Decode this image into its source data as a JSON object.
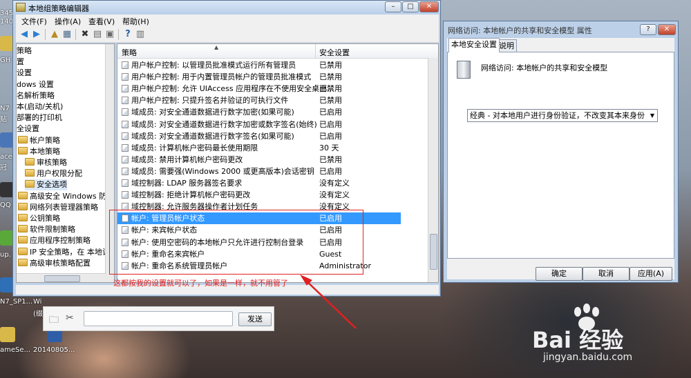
{
  "desktop": {
    "labels": [
      "345",
      "140",
      "GH",
      "N7",
      "贴",
      "ace",
      "冠",
      "QQ",
      "up.",
      "N7_SP1...",
      "Wi",
      "(缀",
      "ameSe...",
      "20140805..."
    ],
    "watermark": "Bai 经验",
    "watermark_url": "jingyan.baidu.com"
  },
  "gpedit": {
    "title": "本地组策略编辑器",
    "menu": [
      "文件(F)",
      "操作(A)",
      "查看(V)",
      "帮助(H)"
    ],
    "tree": [
      {
        "label": "策略",
        "indent": 0
      },
      {
        "label": "置",
        "indent": 0
      },
      {
        "label": "设置",
        "indent": 0
      },
      {
        "label": "dows 设置",
        "indent": 0
      },
      {
        "label": "名解析策略",
        "indent": 0
      },
      {
        "label": "本(启动/关机)",
        "indent": 0
      },
      {
        "label": "部署的打印机",
        "indent": 0
      },
      {
        "label": "全设置",
        "indent": 0
      },
      {
        "label": "帐户策略",
        "indent": 1
      },
      {
        "label": "本地策略",
        "indent": 1
      },
      {
        "label": "审核策略",
        "indent": 2
      },
      {
        "label": "用户权限分配",
        "indent": 2
      },
      {
        "label": "安全选项",
        "indent": 2
      },
      {
        "label": "高级安全 Windows 防火",
        "indent": 1
      },
      {
        "label": "网络列表管理器策略",
        "indent": 1
      },
      {
        "label": "公钥策略",
        "indent": 1
      },
      {
        "label": "软件限制策略",
        "indent": 1
      },
      {
        "label": "应用程序控制策略",
        "indent": 1
      },
      {
        "label": "IP 安全策略，在 本地计",
        "indent": 1
      },
      {
        "label": "高级审核策略配置",
        "indent": 1
      }
    ],
    "columns": {
      "policy": "策略",
      "setting": "安全设置"
    },
    "rows": [
      {
        "policy": "用户帐户控制: 以管理员批准模式运行所有管理员",
        "setting": "已禁用"
      },
      {
        "policy": "用户帐户控制: 用于内置管理员帐户的管理员批准模式",
        "setting": "已禁用"
      },
      {
        "policy": "用户帐户控制: 允许 UIAccess 应用程序在不使用安全桌面...",
        "setting": "已禁用"
      },
      {
        "policy": "用户帐户控制: 只提升签名并验证的可执行文件",
        "setting": "已禁用"
      },
      {
        "policy": "域成员: 对安全通道数据进行数字加密(如果可能)",
        "setting": "已启用"
      },
      {
        "policy": "域成员: 对安全通道数据进行数字加密或数字签名(始终)",
        "setting": "已启用"
      },
      {
        "policy": "域成员: 对安全通道数据进行数字签名(如果可能)",
        "setting": "已启用"
      },
      {
        "policy": "域成员: 计算机帐户密码最长使用期限",
        "setting": "30 天"
      },
      {
        "policy": "域成员: 禁用计算机帐户密码更改",
        "setting": "已禁用"
      },
      {
        "policy": "域成员: 需要强(Windows 2000 或更高版本)会话密钥",
        "setting": "已启用"
      },
      {
        "policy": "域控制器: LDAP 服务器签名要求",
        "setting": "没有定义"
      },
      {
        "policy": "域控制器: 拒绝计算机帐户密码更改",
        "setting": "没有定义"
      },
      {
        "policy": "域控制器: 允许服务器操作者计划任务",
        "setting": "没有定义"
      },
      {
        "policy": "帐户: 管理员帐户状态",
        "setting": "已启用"
      },
      {
        "policy": "帐户: 来宾帐户状态",
        "setting": "已启用"
      },
      {
        "policy": "帐户: 使用空密码的本地帐户只允许进行控制台登录",
        "setting": "已启用"
      },
      {
        "policy": "帐户: 重命名来宾帐户",
        "setting": "Guest"
      },
      {
        "policy": "帐户: 重命名系统管理员帐户",
        "setting": "Administrator"
      }
    ],
    "selected_row": 13
  },
  "annotation": {
    "text": "这都按我的设置就可以了，如果是一样，就不用管了",
    "color": "#e02020"
  },
  "sendbar": {
    "send_label": "发送"
  },
  "props": {
    "title": "网络访问: 本地帐户的共享和安全模型 属性",
    "tabs": [
      "本地安全设置",
      "说明"
    ],
    "heading": "网络访问: 本地帐户的共享和安全模型",
    "combo_value": "经典 - 对本地用户进行身份验证，不改变其本来身份",
    "buttons": {
      "ok": "确定",
      "cancel": "取消",
      "apply": "应用(A)"
    },
    "help_glyph": "?",
    "close_glyph": "✕"
  },
  "colors": {
    "selection": "#3399ff",
    "window_frame": "#bcd0e8",
    "annotation": "#e02020"
  }
}
